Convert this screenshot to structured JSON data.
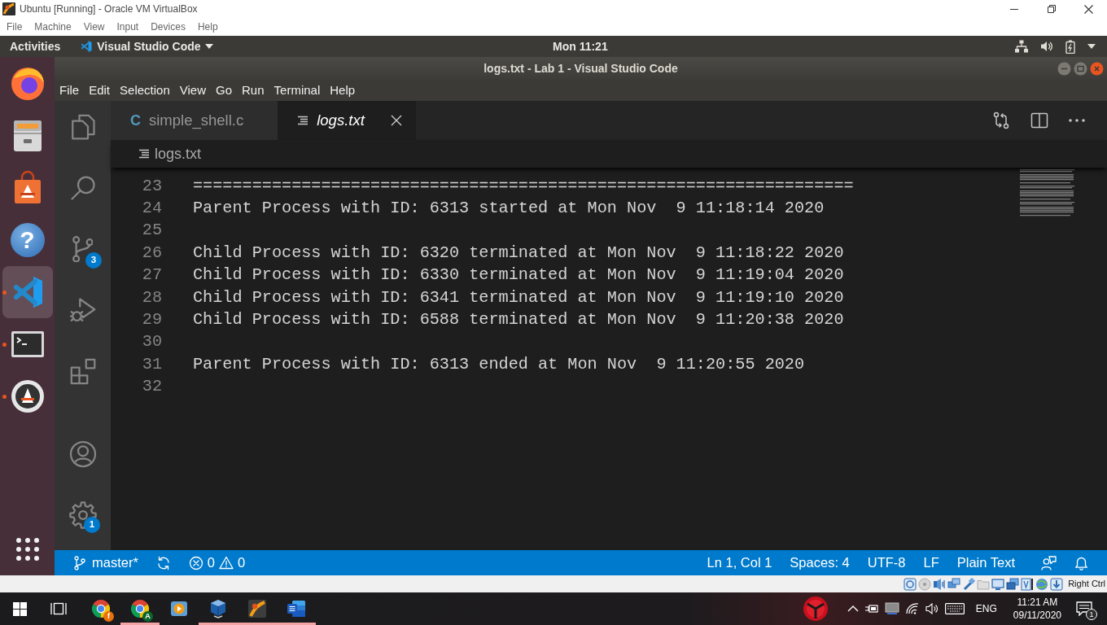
{
  "vbox_window": {
    "title": "Ubuntu [Running] - Oracle VM VirtualBox",
    "menu": [
      "File",
      "Machine",
      "View",
      "Input",
      "Devices",
      "Help"
    ]
  },
  "top_bar": {
    "activities": "Activities",
    "app_menu": "Visual Studio Code",
    "clock": "Mon 11:21"
  },
  "dock": {
    "items": [
      {
        "kind": "browser",
        "running": false,
        "selected": false
      },
      {
        "kind": "files",
        "running": false,
        "selected": false
      },
      {
        "kind": "software",
        "running": false,
        "selected": false
      },
      {
        "kind": "help",
        "glyph": "?",
        "running": false,
        "selected": false
      },
      {
        "kind": "code",
        "running": true,
        "selected": true
      },
      {
        "kind": "terminal",
        "running": true,
        "selected": false
      },
      {
        "kind": "updater",
        "running": true,
        "selected": false
      }
    ]
  },
  "code_window": {
    "title": "logs.txt - Lab 1 - Visual Studio Code",
    "menu": [
      "File",
      "Edit",
      "Selection",
      "View",
      "Go",
      "Run",
      "Terminal",
      "Help"
    ]
  },
  "activity_bar": {
    "items": [
      {
        "kind": "explorer"
      },
      {
        "kind": "search"
      },
      {
        "kind": "source_control",
        "badge": "3"
      },
      {
        "kind": "run"
      },
      {
        "kind": "extensions"
      }
    ],
    "bottom_items": [
      {
        "kind": "account"
      },
      {
        "kind": "settings",
        "badge": "1"
      }
    ]
  },
  "tabs": [
    {
      "label": "simple_shell.c",
      "kind": "c",
      "glyph": "C",
      "selected": false,
      "preview": false
    },
    {
      "label": "logs.txt",
      "kind": "text",
      "selected": true,
      "preview": true
    }
  ],
  "breadcrumb": [
    "logs.txt"
  ],
  "editor": {
    "lines": [
      {
        "number": "23",
        "text": "==================================================================="
      },
      {
        "number": "24",
        "text": "Parent Process with ID: 6313 started at Mon Nov  9 11:18:14 2020"
      },
      {
        "number": "25"
      },
      {
        "number": "26",
        "text": "Child Process with ID: 6320 terminated at Mon Nov  9 11:18:22 2020"
      },
      {
        "number": "27",
        "text": "Child Process with ID: 6330 terminated at Mon Nov  9 11:19:04 2020"
      },
      {
        "number": "28",
        "text": "Child Process with ID: 6341 terminated at Mon Nov  9 11:19:10 2020"
      },
      {
        "number": "29",
        "text": "Child Process with ID: 6588 terminated at Mon Nov  9 11:20:38 2020"
      },
      {
        "number": "30"
      },
      {
        "number": "31",
        "text": "Parent Process with ID: 6313 ended at Mon Nov  9 11:20:55 2020"
      },
      {
        "number": "32"
      }
    ]
  },
  "status_bar": {
    "branch": "master*",
    "errors": "0",
    "warnings": "0",
    "items": [
      "Ln 1, Col 1",
      "Spaces: 4",
      "UTF-8",
      "LF",
      "Plain Text"
    ]
  },
  "vbox_status": {
    "host_key": "Right Ctrl"
  },
  "taskbar": {
    "apps": [
      {
        "kind": "chrome",
        "badge": "f",
        "color": "#e8710a",
        "running": false
      },
      {
        "kind": "chrome",
        "badge": "A",
        "color": "#0d652d",
        "running": true
      },
      {
        "kind": "media",
        "running": false
      },
      {
        "kind": "virtualbox",
        "running": true
      },
      {
        "kind": "app",
        "running": true
      },
      {
        "kind": "word",
        "running": true
      }
    ],
    "tray": {
      "language": "ENG",
      "time": "11:21 AM",
      "date": "09/11/2020",
      "notifications": "1"
    }
  }
}
